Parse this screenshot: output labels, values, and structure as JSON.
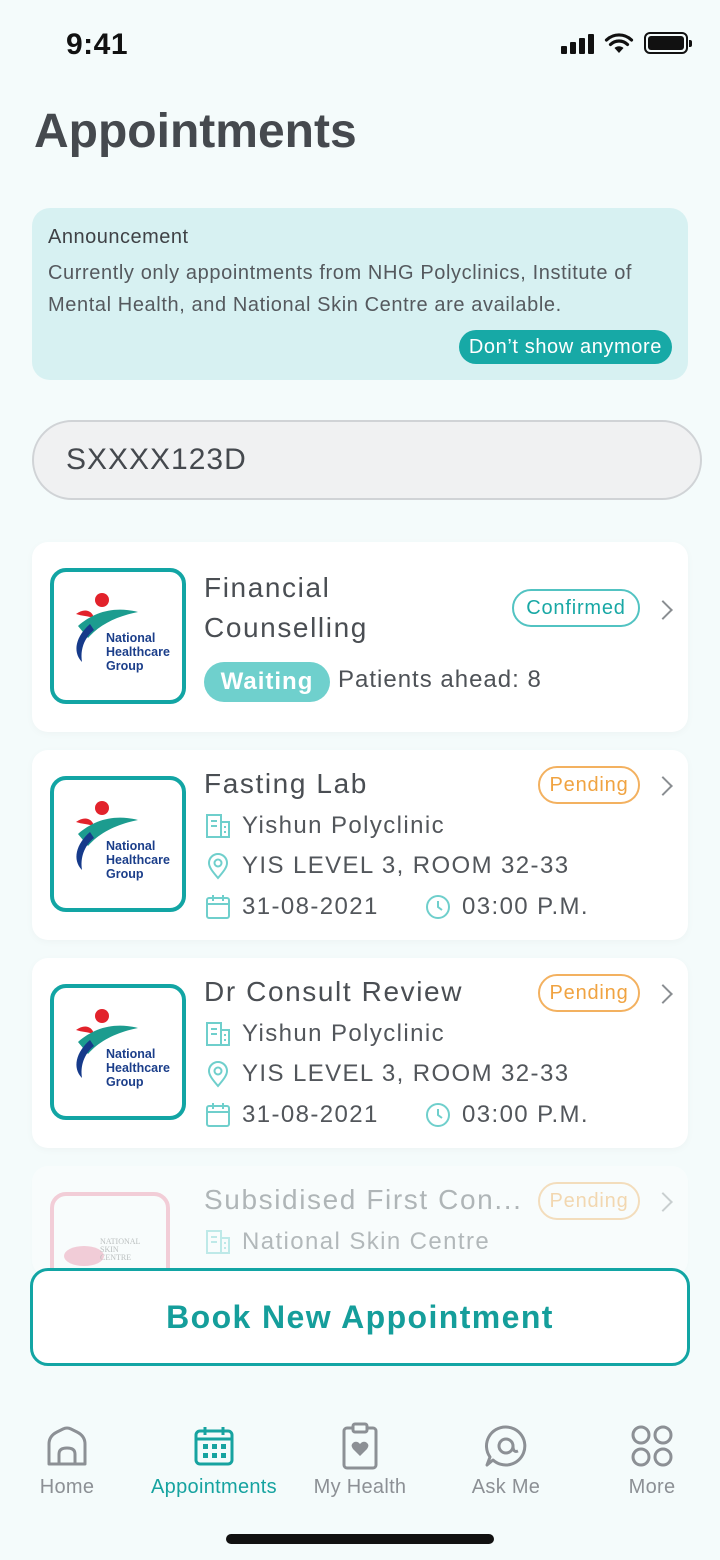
{
  "status_bar": {
    "time": "9:41"
  },
  "page": {
    "title": "Appointments"
  },
  "announcement": {
    "heading": "Announcement",
    "body": "Currently only appointments from NHG Polyclinics, Institute of Mental Health, and National Skin Centre are available.",
    "dismiss_label": "Don’t show anymore"
  },
  "patient": {
    "id": "SXXXX123D"
  },
  "logos": {
    "nhg": {
      "line1": "National",
      "line2": "Healthcare",
      "line3": "Group"
    },
    "nsc": {
      "line1": "NATIONAL",
      "line2": "SKIN",
      "line3": "CENTRE"
    }
  },
  "appointments": [
    {
      "title_line1": "Financial",
      "title_line2": "Counselling",
      "status": "Confirmed",
      "queue_label": "Waiting",
      "patients_ahead": "Patients ahead: 8"
    },
    {
      "title": "Fasting Lab",
      "status": "Pending",
      "clinic": "Yishun Polyclinic",
      "location": "YIS LEVEL 3, ROOM 32-33",
      "date": "31-08-2021",
      "time": "03:00 P.M."
    },
    {
      "title": "Dr Consult Review",
      "status": "Pending",
      "clinic": "Yishun Polyclinic",
      "location": "YIS LEVEL 3, ROOM 32-33",
      "date": "31-08-2021",
      "time": "03:00 P.M."
    },
    {
      "title": "Subsidised First Con...",
      "status": "Pending",
      "clinic": "National Skin Centre"
    }
  ],
  "actions": {
    "book_label": "Book New Appointment"
  },
  "nav": [
    {
      "label": "Home",
      "icon": "home-icon"
    },
    {
      "label": "Appointments",
      "icon": "calendar-icon"
    },
    {
      "label": "My Health",
      "icon": "clipboard-heart-icon"
    },
    {
      "label": "Ask Me",
      "icon": "chat-icon"
    },
    {
      "label": "More",
      "icon": "grid-icon"
    }
  ],
  "colors": {
    "accent": "#12a5a4",
    "pending": "#f0a341",
    "background": "#f4fbfb"
  }
}
